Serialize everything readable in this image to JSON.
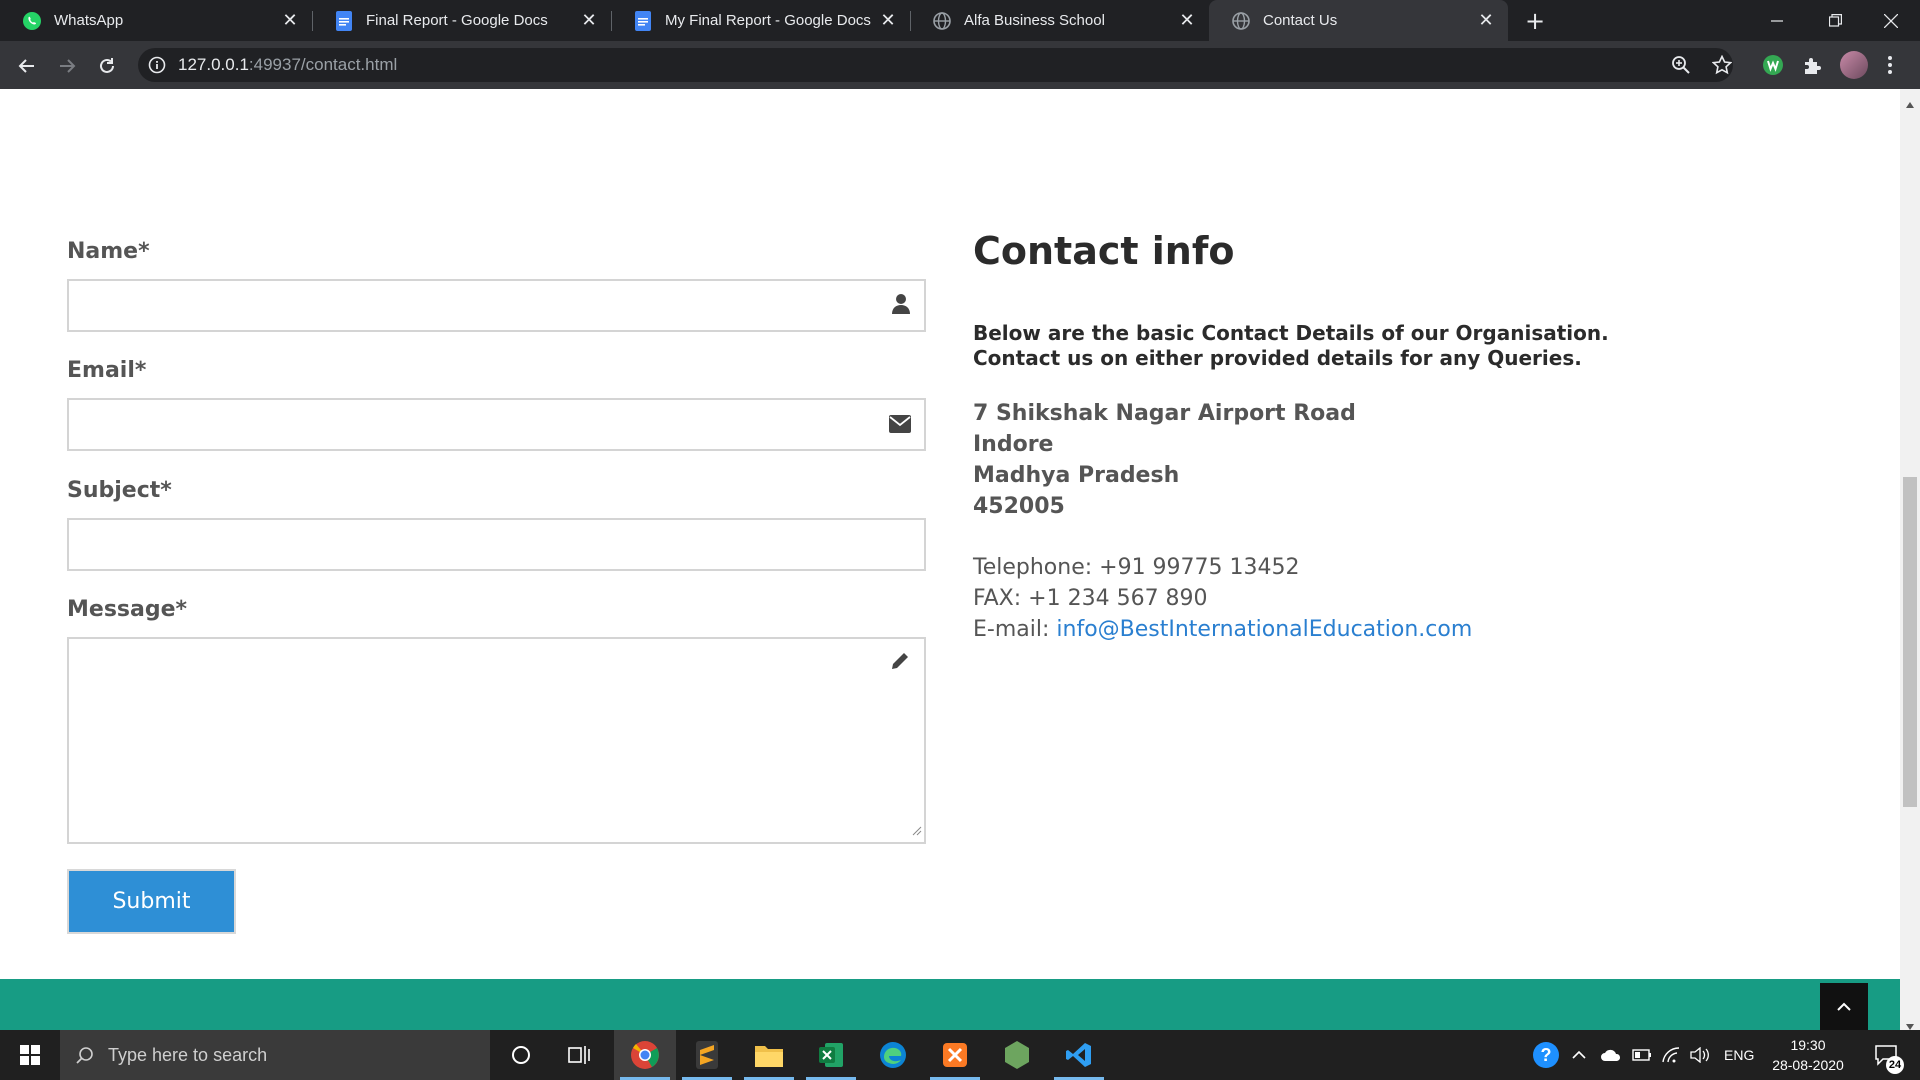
{
  "browser": {
    "tabs": [
      {
        "title": "WhatsApp",
        "icon": "whatsapp-icon",
        "active": false
      },
      {
        "title": "Final Report - Google Docs",
        "icon": "google-docs-icon",
        "active": false
      },
      {
        "title": "My Final Report - Google Docs",
        "icon": "google-docs-icon",
        "active": false
      },
      {
        "title": "Alfa Business School",
        "icon": "globe-icon",
        "active": false
      },
      {
        "title": "Contact Us",
        "icon": "globe-icon",
        "active": true
      }
    ],
    "url_host": "127.0.0.1",
    "url_rest": ":49937/contact.html"
  },
  "form": {
    "name_label": "Name*",
    "email_label": "Email*",
    "subject_label": "Subject*",
    "message_label": "Message*",
    "submit_label": "Submit",
    "name_value": "",
    "email_value": "",
    "subject_value": "",
    "message_value": ""
  },
  "contact": {
    "title": "Contact info",
    "desc_line1": "Below are the basic Contact Details of our Organisation.",
    "desc_line2": "Contact us on either provided details for any Queries.",
    "address": [
      "7 Shikshak Nagar Airport Road",
      "Indore",
      "Madhya Pradesh",
      "452005"
    ],
    "telephone": "Telephone: +91 99775 13452",
    "fax": "FAX: +1 234 567 890",
    "email_label": "E-mail: ",
    "email": "info@BestInternationalEducation.com"
  },
  "taskbar": {
    "search_placeholder": "Type here to search",
    "language": "ENG",
    "time": "19:30",
    "date": "28-08-2020",
    "notification_count": "24"
  },
  "colors": {
    "accent_blue": "#2e8fd6",
    "footer_teal": "#179c84",
    "link_blue": "#2a7fd0"
  }
}
